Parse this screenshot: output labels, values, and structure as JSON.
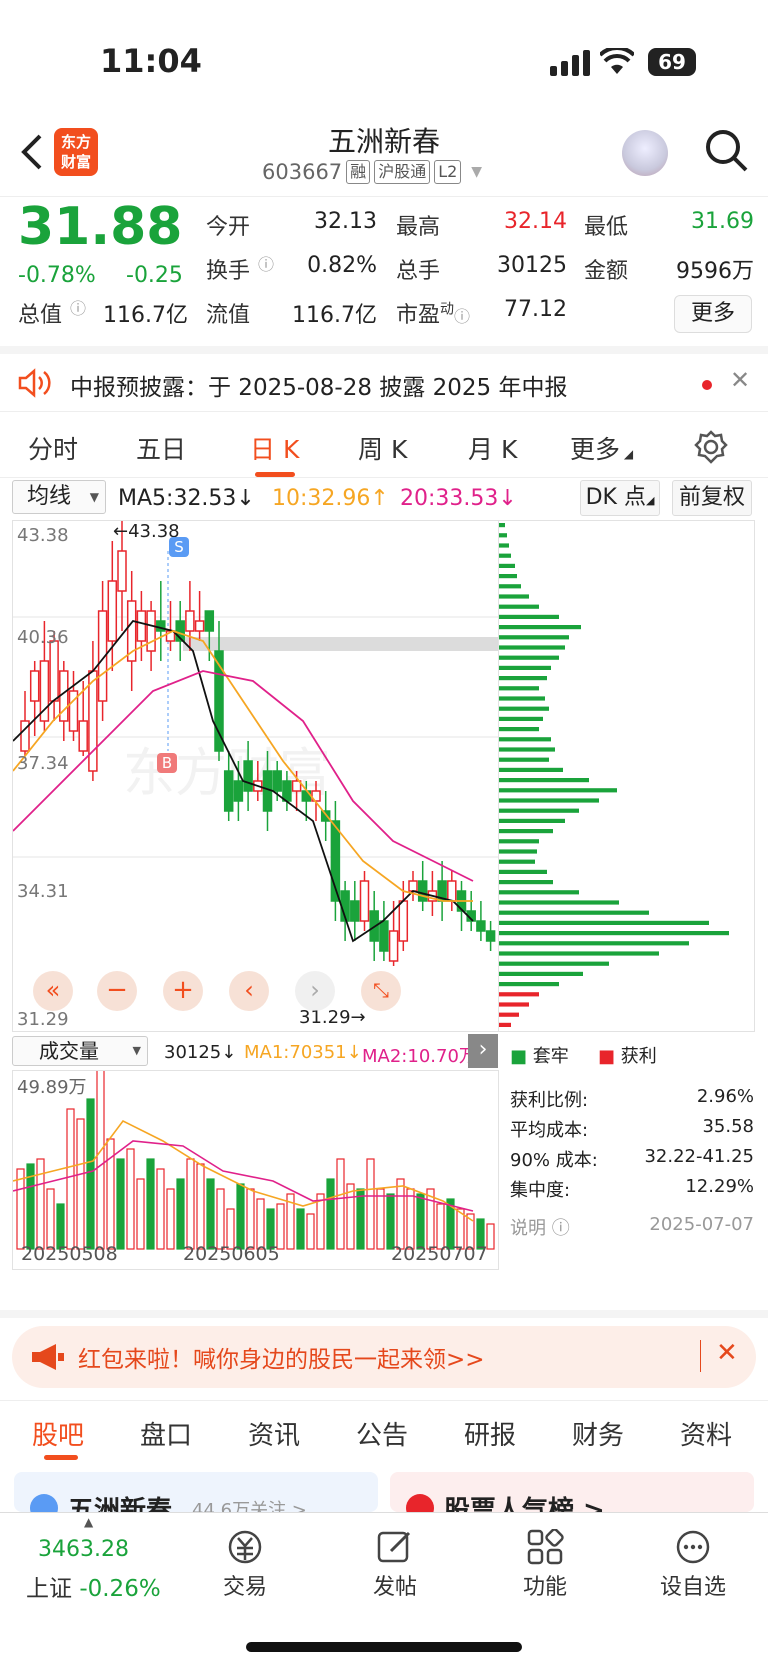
{
  "status": {
    "time": "11:04",
    "battery": "69"
  },
  "header": {
    "title": "五洲新春",
    "code": "603667",
    "tags": [
      "融",
      "沪股通",
      "L2"
    ],
    "logo": "东方财富"
  },
  "quote": {
    "price": "31.88",
    "change_pct": "-0.78%",
    "change": "-0.25",
    "fields": [
      {
        "label": "今开",
        "value": "32.13",
        "color": "#222"
      },
      {
        "label": "最高",
        "value": "32.14",
        "color": "#e8252b"
      },
      {
        "label": "最低",
        "value": "31.69",
        "color": "#1aa33b"
      },
      {
        "label": "换手",
        "value": "0.82%",
        "color": "#222"
      },
      {
        "label": "总手",
        "value": "30125",
        "color": "#222"
      },
      {
        "label": "金额",
        "value": "9596万",
        "color": "#222"
      },
      {
        "label": "总值",
        "value": "116.7亿",
        "color": "#222"
      },
      {
        "label": "流值",
        "value": "116.7亿",
        "color": "#222"
      },
      {
        "label": "市盈",
        "sup": "动",
        "value": "77.12",
        "color": "#222"
      }
    ],
    "more": "更多"
  },
  "notice": {
    "text": "中报预披露：于 2025-08-28 披露 2025 年中报"
  },
  "tabs": [
    "分时",
    "五日",
    "日 K",
    "周 K",
    "月 K",
    "更多"
  ],
  "active_tab": 2,
  "ma": {
    "selector": "均线",
    "ma5": "MA5:32.53↓",
    "ma10": "10:32.96↑",
    "ma20": "20:33.53↓",
    "dk": "DK 点",
    "fq": "前复权"
  },
  "kline": {
    "ylabels": [
      "43.38",
      "40.36",
      "37.34",
      "34.31",
      "31.29"
    ],
    "high_marker": "←43.38",
    "low_marker": "31.29→",
    "s_marker": "S",
    "b_marker": "B",
    "watermark": "东方财富"
  },
  "volume": {
    "selector": "成交量",
    "vol": "30125↓",
    "ma1": "MA1:70351↓",
    "ma2": "MA2:10.70万",
    "max": "49.89万",
    "dates": [
      "20250508",
      "20250605",
      "20250707"
    ]
  },
  "chip": {
    "legend": [
      "套牢",
      "获利"
    ],
    "rows": [
      {
        "label": "获利比例:",
        "value": "2.96%"
      },
      {
        "label": "平均成本:",
        "value": "35.58"
      },
      {
        "label": "90% 成本:",
        "value": "32.22-41.25"
      },
      {
        "label": "集中度:",
        "value": "12.29%"
      }
    ],
    "note": "说明",
    "date": "2025-07-07"
  },
  "banner": {
    "text": "红包来啦！喊你身边的股民一起来领>>"
  },
  "bottom_tabs": [
    "股吧",
    "盘口",
    "资讯",
    "公告",
    "研报",
    "财务",
    "资料"
  ],
  "cards": [
    "五洲新春",
    "44.6万关注 >",
    "股票人气榜 >"
  ],
  "bottom_nav": {
    "index_value": "3463.28",
    "index_name": "上证",
    "index_change": "-0.26%",
    "items": [
      "交易",
      "发帖",
      "功能",
      "设自选"
    ]
  },
  "colors": {
    "up": "#e8252b",
    "down": "#1aa33b",
    "accent": "#f24e1e"
  }
}
